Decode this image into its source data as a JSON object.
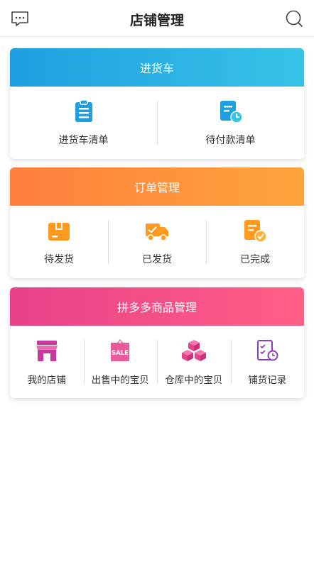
{
  "header": {
    "title": "店铺管理",
    "left_icon": "message-icon",
    "right_icon": "search-icon"
  },
  "sections": [
    {
      "title": "进货车",
      "color": "#1e9fe0",
      "items": [
        {
          "label": "进货车清单",
          "icon": "clipboard-list-icon"
        },
        {
          "label": "待付款清单",
          "icon": "bill-clock-icon"
        }
      ]
    },
    {
      "title": "订单管理",
      "color": "#ff8a3c",
      "items": [
        {
          "label": "待发货",
          "icon": "package-icon"
        },
        {
          "label": "已发货",
          "icon": "delivery-truck-icon"
        },
        {
          "label": "已完成",
          "icon": "document-check-icon"
        }
      ]
    },
    {
      "title": "拼多多商品管理",
      "color": "#e8418a",
      "items": [
        {
          "label": "我的店铺",
          "icon": "storefront-icon",
          "icon_color": "#c8389e"
        },
        {
          "label": "出售中的宝贝",
          "icon": "sale-tag-icon",
          "icon_color": "#e85a9b",
          "icon_text": "SALE"
        },
        {
          "label": "仓库中的宝贝",
          "icon": "boxes-icon",
          "icon_color": "#e8418a"
        },
        {
          "label": "铺货记录",
          "icon": "checklist-clock-icon",
          "icon_color": "#8a3fb8"
        }
      ]
    }
  ]
}
